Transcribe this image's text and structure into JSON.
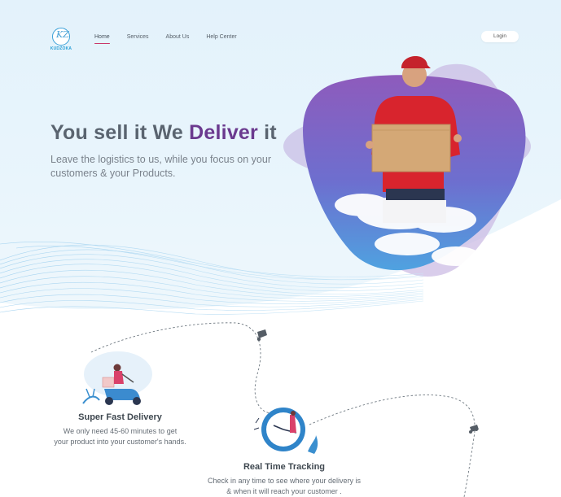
{
  "logo": {
    "mark": "KZ",
    "name": "KUDZOKA"
  },
  "nav": {
    "items": [
      "Home",
      "Services",
      "About Us",
      "Help Center"
    ],
    "active": "Home",
    "login_label": "Login"
  },
  "hero": {
    "title_part1": "You sell it We ",
    "title_accent": "Deliver",
    "title_part2": " it",
    "subtitle": "Leave the logistics to us, while you focus on your customers & your Products."
  },
  "features": [
    {
      "title": "Super Fast Delivery",
      "desc_line1": "We only need 45-60 minutes to get",
      "desc_line2": "your product into your customer's hands."
    },
    {
      "title": "Real Time Tracking",
      "desc_line1": "Check in any time to see where your delivery is",
      "desc_line2": "& when it will reach your customer ."
    }
  ],
  "colors": {
    "accent": "#6b3a8f",
    "nav_underline": "#c9376b",
    "blob_purple": "#8a59b8",
    "blob_blue": "#5a86d6"
  }
}
